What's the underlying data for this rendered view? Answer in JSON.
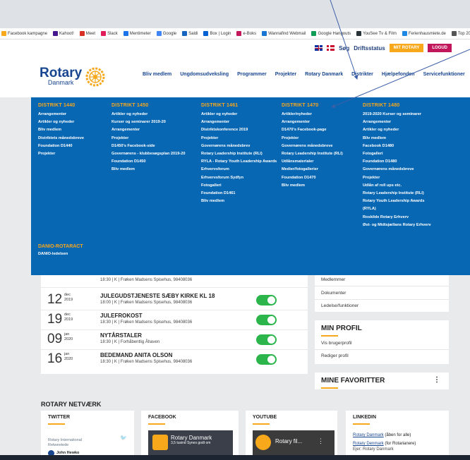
{
  "bookmarks": [
    {
      "label": "Facebook kampagne",
      "color": "#f7a81b"
    },
    {
      "label": "Kahoot!",
      "color": "#46178f"
    },
    {
      "label": "Meet",
      "color": "#d93025"
    },
    {
      "label": "Slack",
      "color": "#e01e5a"
    },
    {
      "label": "Mentimeter",
      "color": "#1a73e8"
    },
    {
      "label": "Google",
      "color": "#4285f4"
    },
    {
      "label": "Saldi",
      "color": "#1565c0"
    },
    {
      "label": "Box | Login",
      "color": "#0061d5"
    },
    {
      "label": "e-Boks",
      "color": "#c2185b"
    },
    {
      "label": "Wannafind Webmail",
      "color": "#1976d2"
    },
    {
      "label": "Google Hangouts",
      "color": "#0f9d58"
    },
    {
      "label": "YouSee Tv & Film",
      "color": "#263238"
    },
    {
      "label": "Ferienhausmiete.de",
      "color": "#1e88e5"
    },
    {
      "label": "Top 20 Web Confe",
      "color": "#555555"
    }
  ],
  "utility": {
    "search": "Søg",
    "status": "Driftsstatus",
    "my_rotary": "MIT ROTARY",
    "logout": "LOGUD"
  },
  "logo": {
    "word": "Rotary",
    "sub": "Danmark"
  },
  "nav": [
    "Bliv medlem",
    "Ungdomsudveksling",
    "Programmer",
    "Projekter",
    "Rotary Danmark",
    "Distrikter",
    "Hjælpefonden",
    "Servicefunktioner"
  ],
  "mega": {
    "columns": [
      {
        "title": "DISTRIKT 1440",
        "items": [
          "Arrangementer",
          "Artikler og nyheder",
          "Bliv medlem",
          "Distriktets månedsbreve",
          "Foundation D1440",
          "Projekter"
        ]
      },
      {
        "title": "DISTRIKT 1450",
        "items": [
          "Artikler og nyheder",
          "Kurser og seminarer 2019-20",
          "Arrangementer",
          "Projekter",
          "D1450's Facebook-side",
          "Governørens - klubbesøgsplan 2019-20",
          "Foundation D1450",
          "Bliv medlem"
        ]
      },
      {
        "title": "DISTRIKT 1461",
        "items": [
          "Artikler og nyheder",
          "Arrangementer",
          "Distriktskonference 2019",
          "Projekter",
          "Governørens månedsbrev",
          "Rotary Leadership Institute (RLI)",
          "RYLA - Rotary Youth Leadership Awards",
          "Erhvervsforum",
          "Erhvervsforum Sydfyn",
          "Fotogalleri",
          "Foundation D1461",
          "Bliv medlem"
        ]
      },
      {
        "title": "DISTRIKT 1470",
        "items": [
          "Artikler/nyheder",
          "Arrangementer",
          "D1470's Facebook-page",
          "Projekter",
          "Governørens månedsbreve",
          "Rotary Leadership Institute (RLI)",
          "Udlånsmaterialer",
          "Medier/fotogallerier",
          "Foundation D1470",
          "Bliv medlem"
        ]
      },
      {
        "title": "DISTRIKT 1480",
        "items": [
          "2019-2020 Kurser og seminarer",
          "Arrangementer",
          "Artikler og nyheder",
          "Bliv medlem",
          "Facebook D1480",
          "Fotogalleri",
          "Foundation D1480",
          "Governørens månedsbreve",
          "Projekter",
          "Udlån af roll ups etc.",
          "Rotary Leadership Institute (RLI)",
          "Rotary Youth Leadership Awards",
          "(RYLA)",
          "Roskilde Rotary Erhverv",
          "Øst- og Midtsjællans Rotary Erhverv"
        ]
      }
    ],
    "danio": {
      "title": "DANIO-ROTARACT",
      "item": "DANIO-ledelsen"
    }
  },
  "events": {
    "first_sub": "18:30 | K | Frøken Madsens Spisehus, 98408036",
    "rows": [
      {
        "day": "12",
        "month": "dec",
        "year": "2019",
        "title": "JULEGUDSTJENESTE SÆBY KIRKE KL 18",
        "sub": "18:00 | K | Frøken Madsens Spisehus, 98408036"
      },
      {
        "day": "19",
        "month": "dec",
        "year": "2019",
        "title": "JULEFROKOST",
        "sub": "18:30 | K | Frøken Madsens Spisehus, 98408036"
      },
      {
        "day": "09",
        "month": "jan",
        "year": "2020",
        "title": "NYTÅRSTALER",
        "sub": "18:30 | K | Forhåbentlig Åhaven"
      },
      {
        "day": "16",
        "month": "jan",
        "year": "2020",
        "title": "BEDEMAND ANITA OLSON",
        "sub": "18:30 | K | Frøken Madsens Spisehus, 98408036"
      }
    ]
  },
  "side": {
    "links": [
      "Medlemmer",
      "Dokumenter",
      "Ledelse/funktioner"
    ],
    "profile_title": "MIN PROFIL",
    "profile_links": [
      "Vis brugerprofil",
      "Rediger profil"
    ],
    "fav_title": "MINE FAVORITTER",
    "fav_more": "⋮"
  },
  "network": {
    "title": "ROTARY NETVÆRK",
    "twitter": {
      "title": "TWITTER",
      "line1": "Rotary International",
      "line2": "Retweetede",
      "line3": "John Hewko"
    },
    "facebook": {
      "title": "FACEBOOK",
      "page": "Rotary Danmark",
      "likes": "3,5 tusind Synes godt om"
    },
    "youtube": {
      "title": "YOUTUBE",
      "video": "Rotary fil..."
    },
    "linkedin": {
      "title": "LINKEDIN",
      "l1": "Rotary Danmark",
      "l1b": " (åben for alle)",
      "l2": "Rotary Denmark",
      "l2b": " (for Rotarianere)",
      "l3": "Ejer: Rotary Danmark"
    }
  }
}
